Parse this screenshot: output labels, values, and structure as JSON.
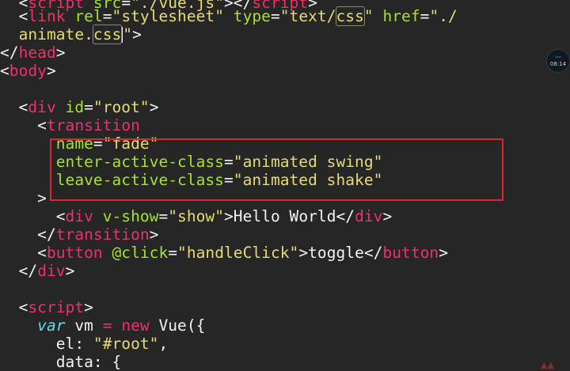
{
  "code": {
    "line0": {
      "indent": "  ",
      "open": "<",
      "tag1": "script",
      "attr": " src",
      "eq": "=",
      "val": "\"./vue.js\"",
      "close": "></",
      "tag2": "script",
      "end": ">"
    },
    "line1": {
      "indent": "  ",
      "open": "<",
      "tag": "link",
      "attr1": " rel",
      "eq1": "=",
      "val1": "\"stylesheet\"",
      "attr2": " type",
      "eq2": "=",
      "val2a": "\"text/",
      "val2b": "css",
      "val2c": "\"",
      "attr3": " href",
      "eq3": "=",
      "val3": "\"./"
    },
    "line2": {
      "indent": "  ",
      "val1": "animate.",
      "val2": "css",
      "val3": "\"",
      "end": ">"
    },
    "line3": {
      "open": "</",
      "tag": "head",
      "end": ">"
    },
    "line4": {
      "open": "<",
      "tag": "body",
      "end": ">"
    },
    "line6": {
      "indent": "  ",
      "open": "<",
      "tag": "div",
      "attr": " id",
      "eq": "=",
      "val": "\"root\"",
      "end": ">"
    },
    "line7": {
      "indent": "    ",
      "open": "<",
      "tag": "transition"
    },
    "line8": {
      "indent": "      ",
      "attr": "name",
      "eq": "=",
      "val": "\"fade\""
    },
    "line9": {
      "indent": "      ",
      "attr": "enter-active-class",
      "eq": "=",
      "val": "\"animated swing\""
    },
    "line10": {
      "indent": "      ",
      "attr": "leave-active-class",
      "eq": "=",
      "val": "\"animated shake\""
    },
    "line11": {
      "indent": "    ",
      "end": ">"
    },
    "line12": {
      "indent": "      ",
      "open": "<",
      "tag1": "div",
      "attr": " v-show",
      "eq": "=",
      "val": "\"show\"",
      "text": ">Hello World</",
      "tag2": "div",
      "end": ">"
    },
    "line13": {
      "indent": "    ",
      "open": "</",
      "tag": "transition",
      "end": ">"
    },
    "line14": {
      "indent": "    ",
      "open": "<",
      "tag1": "button",
      "attr": " @click",
      "eq": "=",
      "val": "\"handleClick\"",
      "text": ">toggle</",
      "tag2": "button",
      "end": ">"
    },
    "line15": {
      "indent": "  ",
      "open": "</",
      "tag": "div",
      "end": ">"
    },
    "line17": {
      "indent": "  ",
      "open": "<",
      "tag": "script",
      "end": ">"
    },
    "line18": {
      "indent": "    ",
      "kw": "var",
      "name": " vm ",
      "op1": "=",
      "sp": " ",
      "op2": "new",
      "rest": " Vue({"
    },
    "line19": {
      "indent": "      ",
      "key": "el: ",
      "val": "\"#root\"",
      "rest": ","
    },
    "line20": {
      "indent": "      ",
      "key": "data: {"
    }
  },
  "badge": {
    "time": "08:14",
    "wave": "〰"
  },
  "corner": "▲▲"
}
